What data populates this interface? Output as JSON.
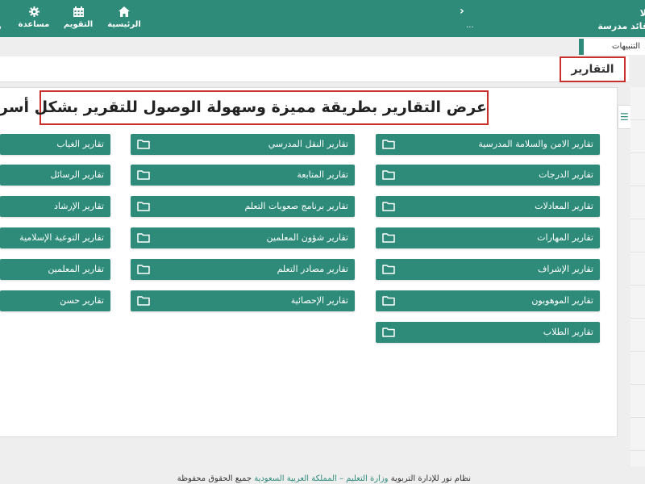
{
  "topnav": {
    "home_label": "الرئيسية",
    "calendar_label": "التقويم",
    "help_label": "مساعدة",
    "chevron": "›",
    "dots": "...",
    "user_line1": "لا",
    "user_line2": "قائد مدرسة"
  },
  "alerts_label": "التنبيهات",
  "page_title": "التقارير",
  "banner_text": "عرض التقارير بطريقة مميزة وسهولة الوصول للتقرير بشكل أسرع",
  "side_strip_icon": "list-icon",
  "reports": {
    "col1": [
      "تقارير الامن والسلامة المدرسية",
      "تقارير الدرجات",
      "تقارير المعادلات",
      "تقارير المهارات",
      "تقارير الإشراف",
      "تقارير الموهوبون",
      "تقارير الطلاب"
    ],
    "col2": [
      "تقارير النقل المدرسي",
      "تقارير المتابعة",
      "تقارير برنامج صعوبات التعلم",
      "تقارير شؤون المعلمين",
      "تقارير مصادر التعلم",
      "تقارير الإحصائية"
    ],
    "col3": [
      "تقارير الغياب",
      "تقارير الرسائل",
      "تقارير الإرشاد",
      "تقارير التوعية الإسلامية",
      "تقارير المعلمين",
      "تقارير حسن"
    ]
  },
  "footer": {
    "prefix": "نظام نور للإدارة التربوية",
    "link": "وزارة التعليم – المملكة العربية السعودية",
    "suffix": "جميع الحقوق محفوظة"
  },
  "colors": {
    "primary": "#2e8b7a",
    "highlight_border": "#c9302c"
  }
}
